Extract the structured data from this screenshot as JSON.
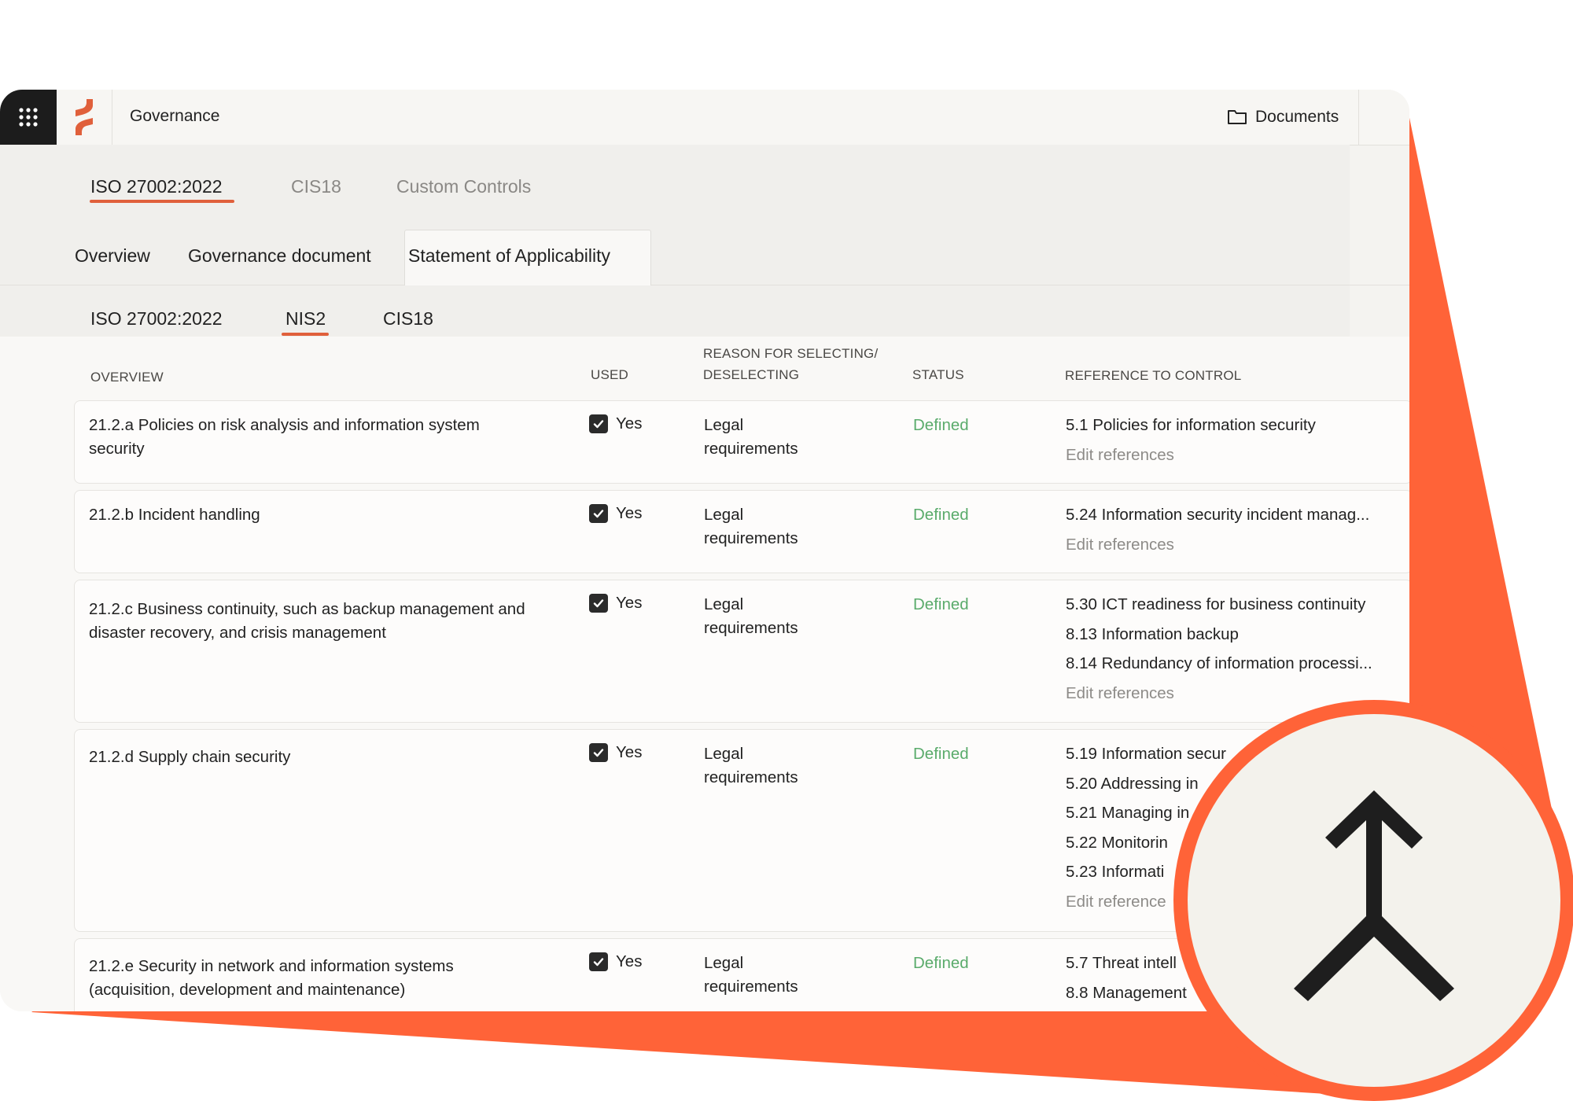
{
  "colors": {
    "accent": "#ff6338",
    "underline": "#e0603b",
    "status_defined": "#5aab6b",
    "dark": "#1c1c1c"
  },
  "topbar": {
    "title": "Governance",
    "documents_label": "Documents",
    "grid_icon": "grid-icon",
    "folder_icon": "folder-icon"
  },
  "frameworks_tabs": [
    "ISO 27002:2022",
    "CIS18",
    "Custom Controls"
  ],
  "section_tabs": [
    "Overview",
    "Governance document",
    "Statement of Applicability"
  ],
  "soa_tabs": [
    "ISO 27002:2022",
    "NIS2",
    "CIS18"
  ],
  "columns": {
    "overview": "OVERVIEW",
    "used": "USED",
    "reason_1": "REASON FOR SELECTING/",
    "reason_2": "DESELECTING",
    "status": "STATUS",
    "reference": "REFERENCE TO CONTROL"
  },
  "rows": [
    {
      "overview": "21.2.a Policies on risk analysis and information system security",
      "used": "Yes",
      "reason": "Legal requirements",
      "status": "Defined",
      "refs": [
        "5.1 Policies for information security",
        "Edit references"
      ]
    },
    {
      "overview": "21.2.b Incident handling",
      "used": "Yes",
      "reason": "Legal requirements",
      "status": "Defined",
      "refs": [
        "5.24 Information security incident manag...",
        "Edit references"
      ]
    },
    {
      "overview": "21.2.c Business continuity, such as backup management and disaster recovery, and crisis management",
      "used": "Yes",
      "reason": "Legal requirements",
      "status": "Defined",
      "refs": [
        "5.30 ICT readiness for business continuity",
        "8.13 Information backup",
        "8.14 Redundancy of information processi...",
        "Edit references"
      ]
    },
    {
      "overview": "21.2.d Supply chain security",
      "used": "Yes",
      "reason": "Legal requirements",
      "status": "Defined",
      "refs": [
        "5.19 Information secur",
        "5.20 Addressing in",
        "5.21 Managing in",
        "5.22 Monitorin",
        "5.23 Informati",
        "Edit reference"
      ]
    },
    {
      "overview": "21.2.e Security in network and information systems (acquisition, development and maintenance)",
      "used": "Yes",
      "reason": "Legal requirements",
      "status": "Defined",
      "refs": [
        "5.7 Threat intell",
        "8.8 Management"
      ]
    }
  ],
  "badge_icon": "merge-arrow-icon"
}
